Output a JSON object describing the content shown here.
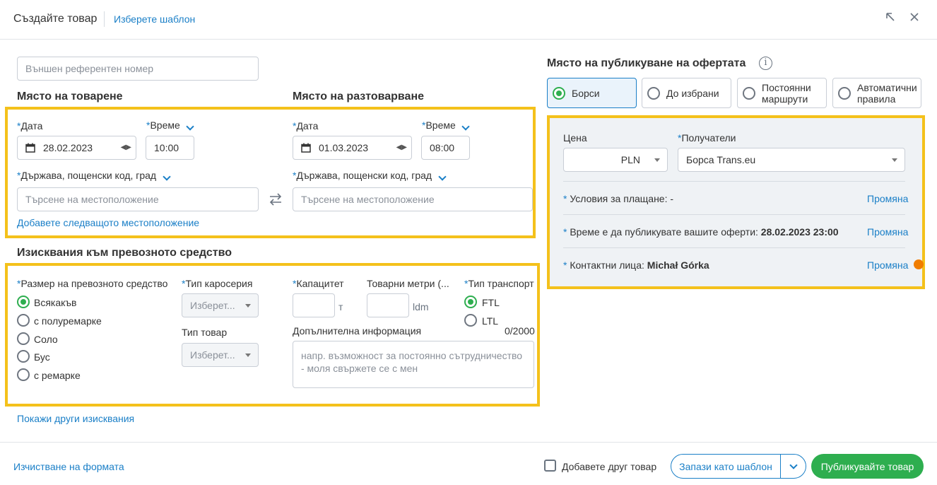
{
  "header": {
    "title": "Създайте товар",
    "template_link": "Изберете шаблон"
  },
  "external_ref": {
    "placeholder": "Външен референтен номер"
  },
  "loading": {
    "title": "Място на товарене",
    "date_label": "Дата",
    "date_value": "28.02.2023",
    "time_label": "Време",
    "time_value": "10:00",
    "location_label": "Държава, пощенски код, град",
    "location_placeholder": "Търсене на местоположение",
    "add_location": "Добавете следващото местоположение"
  },
  "unloading": {
    "title": "Място на разтоварване",
    "date_label": "Дата",
    "date_value": "01.03.2023",
    "time_label": "Време",
    "time_value": "08:00",
    "location_label": "Държава, пощенски код, град",
    "location_placeholder": "Търсене на местоположение"
  },
  "vehicle": {
    "title": "Изисквания към превозното средство",
    "size_label": "Размер на превозното средство",
    "sizes": [
      "Всякакъв",
      "с полуремарке",
      "Соло",
      "Бус",
      "с ремарке"
    ],
    "selected_size": "Всякакъв",
    "body_label": "Тип каросерия",
    "body_placeholder": "Изберет...",
    "goods_label": "Тип товар",
    "goods_placeholder": "Изберет...",
    "capacity_label": "Капацитет",
    "capacity_unit": "т",
    "ldm_label": "Товарни метри (...",
    "ldm_unit": "ldm",
    "transport_label": "Тип транспорт",
    "transport_options": [
      "FTL",
      "LTL"
    ],
    "selected_transport": "FTL",
    "info_label": "Допълнителна информация",
    "info_counter": "0/2000",
    "info_placeholder": "напр. възможност за постоянно сътрудничество - моля свържете се с мен",
    "more_link": "Покажи други изисквания"
  },
  "publish": {
    "title": "Място на публикуване на офертата",
    "tabs": [
      "Борси",
      "До избрани",
      "Постоянни маршрути",
      "Автоматични правила"
    ],
    "active_tab": "Борси",
    "price_label": "Цена",
    "currency": "PLN",
    "recipients_label": "Получатели",
    "recipients_value": "Борса Trans.eu",
    "payment_label": "Условия за плащане: -",
    "publish_time_label": "Време е да публикувате вашите оферти: ",
    "publish_time_value": "28.02.2023 23:00",
    "contacts_label": "Контактни лица: ",
    "contacts_value": "Michał Górka",
    "change": "Промяна"
  },
  "footer": {
    "clear": "Изчистване на формата",
    "add_another": "Добавете друг товар",
    "save_template": "Запази като шаблон",
    "publish": "Публикувайте товар"
  },
  "colors": {
    "accent": "#1a7fc7",
    "success": "#2eae4f",
    "highlight": "#f4c11b",
    "notification": "#f07d00"
  }
}
